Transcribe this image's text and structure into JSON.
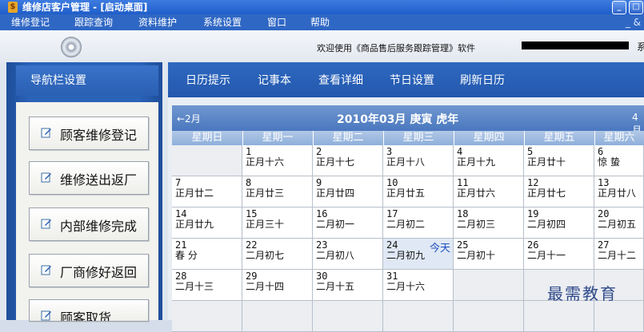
{
  "window": {
    "title": "维修店客户管理 - [启动桌面]"
  },
  "menu": {
    "items": [
      "维修登记",
      "跟踪查询",
      "资料维护",
      "系统设置",
      "窗口",
      "帮助"
    ],
    "corner": "_ &"
  },
  "toolbar": {
    "welcome": "欢迎使用《商品售后服务跟踪管理》软件",
    "trailing": "系"
  },
  "nav": {
    "header": "导航栏设置",
    "buttons": [
      "顾客维修登记",
      "维修送出返厂",
      "内部维修完成",
      "厂商修好返回",
      "顾客取货"
    ]
  },
  "tabs": [
    "日历提示",
    "记事本",
    "查看详细",
    "节日设置",
    "刷新日历"
  ],
  "calendar": {
    "prev": "←2月",
    "title": "2010年03月   庚寅 虎年",
    "next": "4月",
    "weekdays": [
      "星期日",
      "星期一",
      "星期二",
      "星期三",
      "星期四",
      "星期五",
      "星期六"
    ],
    "today_label": "今天",
    "cells": [
      {
        "d": "",
        "l": "",
        "empty": true
      },
      {
        "d": "1",
        "l": "正月十六"
      },
      {
        "d": "2",
        "l": "正月十七"
      },
      {
        "d": "3",
        "l": "正月十八"
      },
      {
        "d": "4",
        "l": "正月十九"
      },
      {
        "d": "5",
        "l": "正月廿十"
      },
      {
        "d": "6",
        "l": "惊 蛰"
      },
      {
        "d": "7",
        "l": "正月廿二"
      },
      {
        "d": "8",
        "l": "正月廿三"
      },
      {
        "d": "9",
        "l": "正月廿四"
      },
      {
        "d": "10",
        "l": "正月廿五"
      },
      {
        "d": "11",
        "l": "正月廿六"
      },
      {
        "d": "12",
        "l": "正月廿七"
      },
      {
        "d": "13",
        "l": "正月廿八"
      },
      {
        "d": "14",
        "l": "正月廿九"
      },
      {
        "d": "15",
        "l": "正月三十"
      },
      {
        "d": "16",
        "l": "二月初一"
      },
      {
        "d": "17",
        "l": "二月初二"
      },
      {
        "d": "18",
        "l": "二月初三"
      },
      {
        "d": "19",
        "l": "二月初四"
      },
      {
        "d": "20",
        "l": "二月初五"
      },
      {
        "d": "21",
        "l": "春 分"
      },
      {
        "d": "22",
        "l": "二月初七"
      },
      {
        "d": "23",
        "l": "二月初八"
      },
      {
        "d": "24",
        "l": "二月初九",
        "today": true
      },
      {
        "d": "25",
        "l": "二月初十"
      },
      {
        "d": "26",
        "l": "二月十一"
      },
      {
        "d": "27",
        "l": "二月十二"
      },
      {
        "d": "28",
        "l": "二月十三"
      },
      {
        "d": "29",
        "l": "二月十四"
      },
      {
        "d": "30",
        "l": "二月十五"
      },
      {
        "d": "31",
        "l": "二月十六"
      },
      {
        "d": "",
        "l": "",
        "empty": true
      },
      {
        "d": "",
        "l": "",
        "empty": true
      },
      {
        "d": "",
        "l": "",
        "empty": true
      },
      {
        "d": "",
        "l": "",
        "empty": true
      },
      {
        "d": "",
        "l": "",
        "empty": true
      },
      {
        "d": "",
        "l": "",
        "empty": true
      },
      {
        "d": "",
        "l": "",
        "empty": true
      },
      {
        "d": "",
        "l": "",
        "empty": true
      },
      {
        "d": "",
        "l": "",
        "empty": true
      },
      {
        "d": "",
        "l": "",
        "empty": true
      }
    ]
  },
  "watermark": "最需教育"
}
